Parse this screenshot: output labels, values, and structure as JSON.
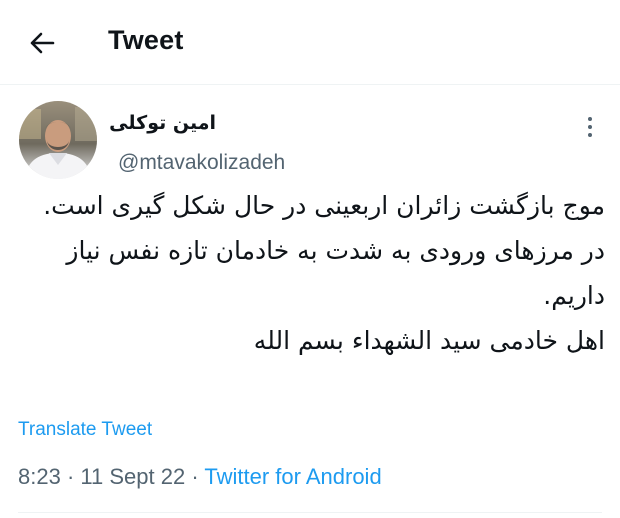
{
  "header": {
    "title": "Tweet",
    "back_icon": "arrow-left-icon"
  },
  "tweet": {
    "author_name": "امین توکلی",
    "handle": "@mtavakolizadeh",
    "text": "موج بازگشت زائران اربعینی در حال شکل گیری است.\nدر مرزهای ورودی به شدت به خادمان تازه نفس نیاز داریم.\nاهل خادمی سید الشهداء بسم الله",
    "translate_label": "Translate Tweet",
    "time": "8:23",
    "separator": "·",
    "date": "11 Sept 22",
    "source": "Twitter for Android",
    "more_icon": "more-vertical-icon"
  },
  "colors": {
    "accent": "#1d9bf0",
    "text_primary": "#0f1419",
    "text_secondary": "#536471",
    "divider": "#eff3f4"
  }
}
